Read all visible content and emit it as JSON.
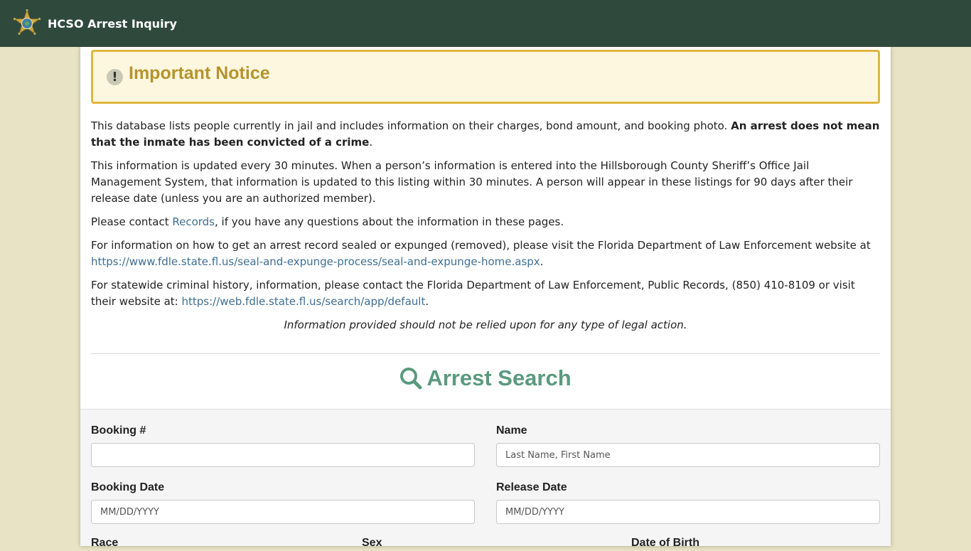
{
  "navbar": {
    "title": "HCSO Arrest Inquiry",
    "badge_icon": "sheriff-star-icon",
    "background": "#2f4a3c"
  },
  "notice": {
    "icon": "exclamation-icon",
    "title": "Important Notice"
  },
  "paragraphs": {
    "p1_text": "This database lists people currently in jail and includes information on their charges, bond amount, and booking photo. ",
    "p1_bold": "An arrest does not mean that the inmate has been convicted of a crime",
    "p1_end": ".",
    "p2": "This information is updated every 30 minutes. When a person’s information is entered into the Hillsborough County Sheriff’s Office Jail Management System, that information is updated to this listing within 30 minutes. A person will appear in these listings for 90 days after their release date (unless you are an authorized member).",
    "p3_before": "Please contact ",
    "p3_link": "Records",
    "p3_after": ", if you have any questions about the information in these pages.",
    "p4_text": "For information on how to get an arrest record sealed or expunged (removed), please visit the Florida Department of Law Enforcement website at ",
    "p4_link": "https://www.fdle.state.fl.us/seal-and-expunge-process/seal-and-expunge-home.aspx",
    "p4_end": ".",
    "p5_text": "For statewide criminal history, information, please contact the Florida Department of Law Enforcement, Public Records, (850) 410-8109 or visit their website at: ",
    "p5_link": "https://web.fdle.state.fl.us/search/app/default",
    "p5_end": ".",
    "disclaimer": "Information provided should not be relied upon for any type of legal action."
  },
  "search": {
    "icon": "search-icon",
    "heading": "Arrest Search",
    "fields": {
      "booking_number": {
        "label": "Booking #",
        "value": "",
        "placeholder": ""
      },
      "name": {
        "label": "Name",
        "value": "",
        "placeholder": "Last Name, First Name"
      },
      "booking_date": {
        "label": "Booking Date",
        "value": "",
        "placeholder": "MM/DD/YYYY"
      },
      "release_date": {
        "label": "Release Date",
        "value": "",
        "placeholder": "MM/DD/YYYY"
      },
      "race": {
        "label": "Race"
      },
      "sex": {
        "label": "Sex"
      },
      "dob": {
        "label": "Date of Birth"
      }
    }
  },
  "colors": {
    "page_background": "#e8e3c4",
    "notice_border": "#e0b640",
    "notice_title": "#b5942c",
    "link": "#3e6f92",
    "search_heading": "#5a9a7f"
  }
}
